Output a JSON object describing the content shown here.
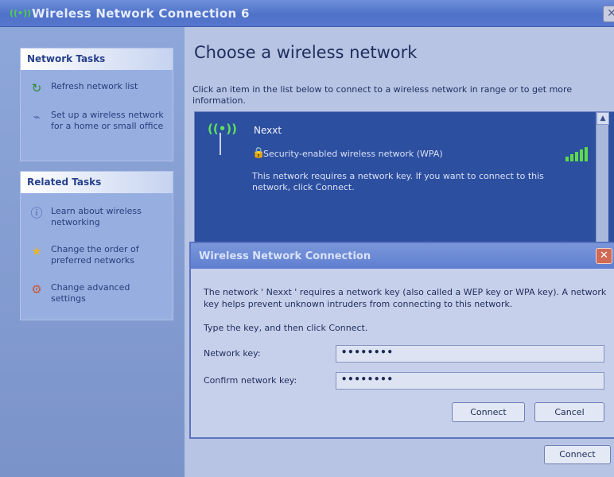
{
  "window": {
    "title": "Wireless Network Connection 6",
    "close_glyph": "✕"
  },
  "network_tasks": {
    "heading": "Network Tasks",
    "items": [
      {
        "icon": "refresh-icon",
        "label": "Refresh network list"
      },
      {
        "icon": "wireless-setup-icon",
        "label": "Set up a wireless network for a home or small office"
      }
    ]
  },
  "related_tasks": {
    "heading": "Related Tasks",
    "items": [
      {
        "icon": "info-icon",
        "label": "Learn about wireless networking"
      },
      {
        "icon": "star-icon",
        "label": "Change the order of preferred networks"
      },
      {
        "icon": "settings-icon",
        "label": "Change advanced settings"
      }
    ]
  },
  "main": {
    "title": "Choose a wireless network",
    "description": "Click an item in the list below to connect to a wireless network in range or to get more information.",
    "connect_label": "Connect"
  },
  "network": {
    "name": "Nexxt",
    "security": "Security-enabled wireless network (WPA)",
    "description": "This network requires a network key. If you want to connect to this network, click Connect.",
    "signal_bars": 5
  },
  "dialog": {
    "title": "Wireless Network Connection",
    "message": "The network ' Nexxt ' requires a network key (also called a WEP key or WPA key). A network key helps prevent unknown intruders from connecting to this network.",
    "instruction": "Type the key, and then click Connect.",
    "key_label": "Network key:",
    "confirm_label": "Confirm network key:",
    "key_value": "••••••••",
    "confirm_value": "••••••••",
    "connect_label": "Connect",
    "cancel_label": "Cancel"
  }
}
